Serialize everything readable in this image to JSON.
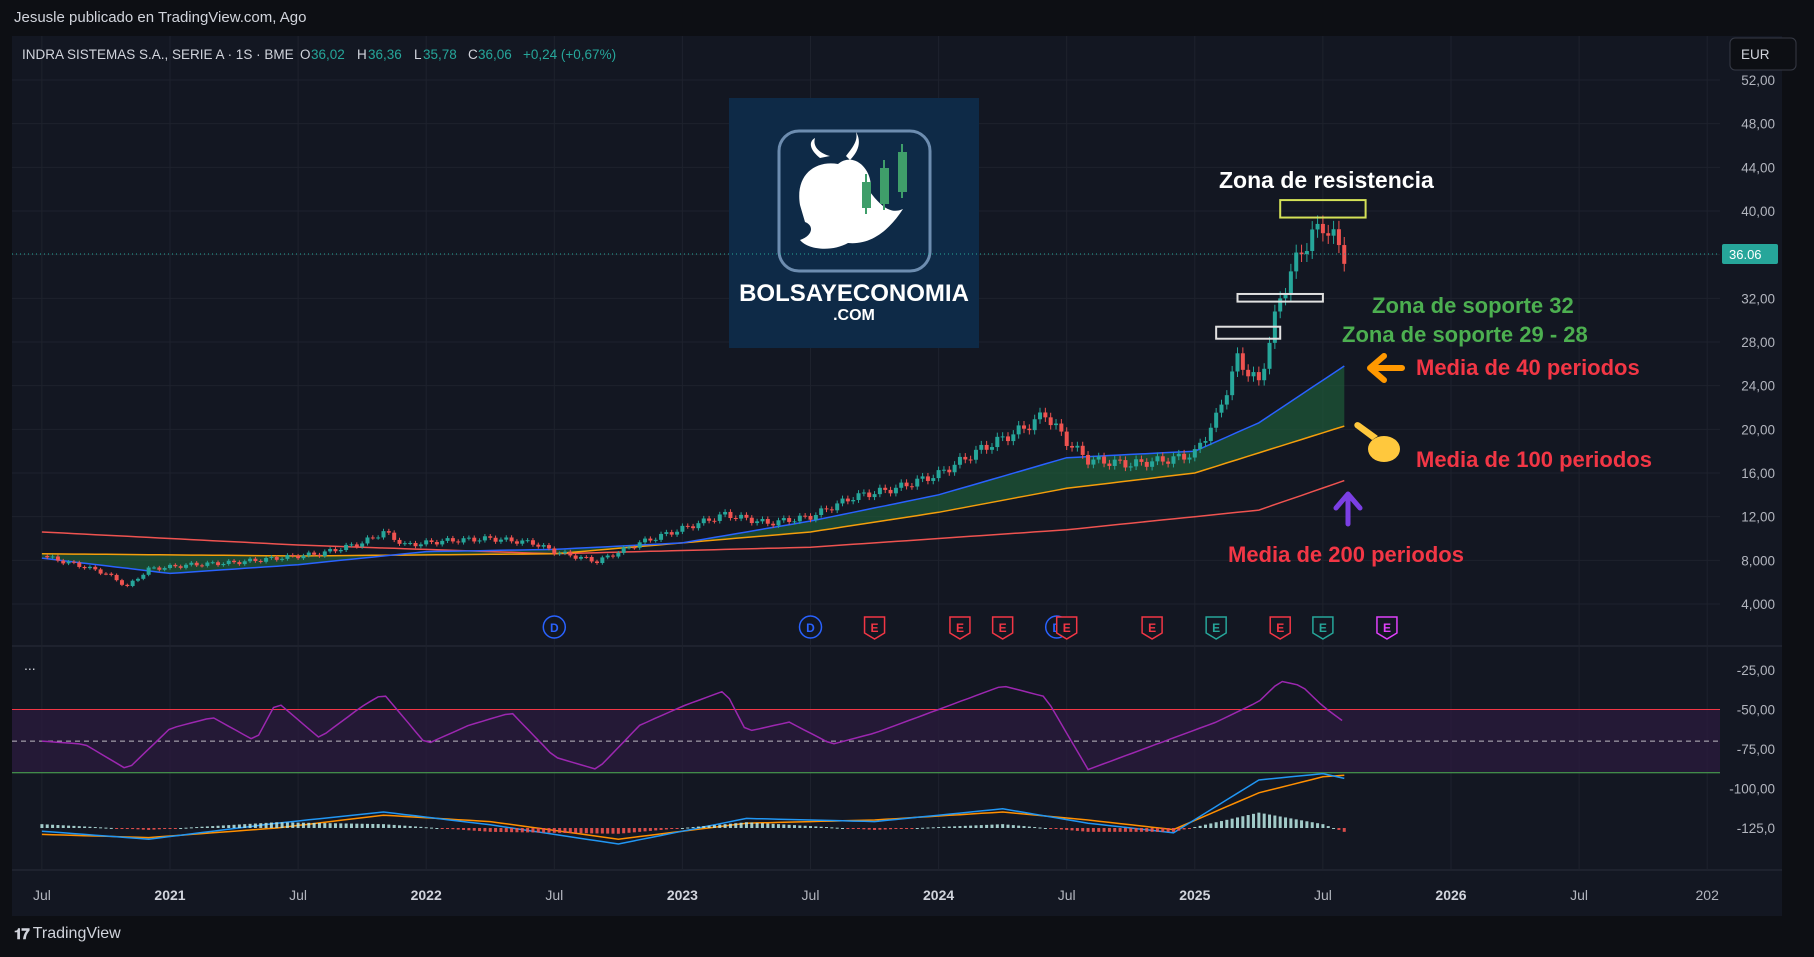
{
  "header": {
    "published_by": "Jesusle publicado en TradingView.com, Ago",
    "symbol": "INDRA SISTEMAS S.A., SERIE A · 1S · BME",
    "o_label": "O",
    "o_value": "36,02",
    "h_label": "H",
    "h_value": "36,36",
    "l_label": "L",
    "l_value": "35,78",
    "c_label": "C",
    "c_value": "36,06",
    "change": "+0,24 (+0,67%)",
    "currency": "EUR",
    "last_price": "36.06"
  },
  "footer": {
    "brand": "TradingView"
  },
  "logo": {
    "line1": "BOLSAYECONOMIA",
    "line2": ".COM"
  },
  "colors": {
    "background": "#131722",
    "ma40": "#2962ff",
    "ma100": "#f59e0b",
    "ma200": "#ef5350",
    "fill_band": "#1f5f3a",
    "rsi": "#9c27b0",
    "macd": "#2196f3",
    "signal": "#ff8f00",
    "up": "#26a69a",
    "down": "#ef5350",
    "annotation_green": "#4caf50",
    "annotation_red": "#f23645",
    "resistance_box": "#d4e157"
  },
  "annotations": {
    "resistance": "Zona de resistencia",
    "support32": "Zona de soporte 32",
    "support29": "Zona de soporte 29 - 28",
    "ma40": "Media de 40 periodos",
    "ma100": "Media de 100 periodos",
    "ma200": "Media de 200 periodos"
  },
  "chart_data": {
    "type": "line",
    "title": "INDRA SISTEMAS S.A., SERIE A · 1S · BME",
    "xlabel": "",
    "ylabel": "",
    "x_ticks": [
      "Jul",
      "2021",
      "Jul",
      "2022",
      "Jul",
      "2023",
      "Jul",
      "2024",
      "Jul",
      "2025",
      "Jul",
      "2026",
      "Jul",
      "202"
    ],
    "y_ticks": [
      "52,00",
      "48,00",
      "44,00",
      "40,00",
      "36,00",
      "32,00",
      "28,00",
      "24,00",
      "20,00",
      "16,00",
      "12,00",
      "8,000",
      "4,000"
    ],
    "ylim": [
      4,
      52
    ],
    "price_points": [
      {
        "date": "2020-07",
        "value": 8.4
      },
      {
        "date": "2020-09",
        "value": 7.4
      },
      {
        "date": "2020-10",
        "value": 6.8
      },
      {
        "date": "2020-11",
        "value": 5.6
      },
      {
        "date": "2020-12",
        "value": 7.2
      },
      {
        "date": "2021-02",
        "value": 7.6
      },
      {
        "date": "2021-04",
        "value": 7.8
      },
      {
        "date": "2021-06",
        "value": 8.2
      },
      {
        "date": "2021-08",
        "value": 8.6
      },
      {
        "date": "2021-10",
        "value": 9.6
      },
      {
        "date": "2021-11",
        "value": 10.6
      },
      {
        "date": "2021-12",
        "value": 9.4
      },
      {
        "date": "2022-02",
        "value": 9.8
      },
      {
        "date": "2022-04",
        "value": 10.0
      },
      {
        "date": "2022-06",
        "value": 9.6
      },
      {
        "date": "2022-07",
        "value": 8.8
      },
      {
        "date": "2022-09",
        "value": 7.9
      },
      {
        "date": "2022-11",
        "value": 9.6
      },
      {
        "date": "2023-01",
        "value": 10.9
      },
      {
        "date": "2023-03",
        "value": 12.2
      },
      {
        "date": "2023-05",
        "value": 11.4
      },
      {
        "date": "2023-07",
        "value": 12.0
      },
      {
        "date": "2023-09",
        "value": 13.8
      },
      {
        "date": "2023-11",
        "value": 14.6
      },
      {
        "date": "2024-01",
        "value": 15.9
      },
      {
        "date": "2024-03",
        "value": 18.2
      },
      {
        "date": "2024-05",
        "value": 20.1
      },
      {
        "date": "2024-06",
        "value": 21.4
      },
      {
        "date": "2024-07",
        "value": 18.9
      },
      {
        "date": "2024-08",
        "value": 17.2
      },
      {
        "date": "2024-10",
        "value": 16.8
      },
      {
        "date": "2024-12",
        "value": 17.3
      },
      {
        "date": "2025-01",
        "value": 17.8
      },
      {
        "date": "2025-02",
        "value": 21.0
      },
      {
        "date": "2025-03",
        "value": 26.4
      },
      {
        "date": "2025-04",
        "value": 24.2
      },
      {
        "date": "2025-05",
        "value": 32.0
      },
      {
        "date": "2025-06",
        "value": 36.5
      },
      {
        "date": "2025-07",
        "value": 38.8
      },
      {
        "date": "2025-08",
        "value": 36.06
      }
    ],
    "series": [
      {
        "name": "Media de 40 periodos",
        "values": [
          {
            "date": "2020-07",
            "value": 8.2
          },
          {
            "date": "2021-01",
            "value": 6.8
          },
          {
            "date": "2021-07",
            "value": 7.6
          },
          {
            "date": "2022-01",
            "value": 8.8
          },
          {
            "date": "2022-07",
            "value": 9.0
          },
          {
            "date": "2023-01",
            "value": 9.6
          },
          {
            "date": "2023-07",
            "value": 11.6
          },
          {
            "date": "2024-01",
            "value": 14.0
          },
          {
            "date": "2024-07",
            "value": 17.4
          },
          {
            "date": "2025-01",
            "value": 18.0
          },
          {
            "date": "2025-04",
            "value": 20.6
          },
          {
            "date": "2025-08",
            "value": 25.8
          }
        ]
      },
      {
        "name": "Media de 100 periodos",
        "values": [
          {
            "date": "2020-07",
            "value": 8.6
          },
          {
            "date": "2021-07",
            "value": 8.4
          },
          {
            "date": "2022-07",
            "value": 8.6
          },
          {
            "date": "2023-07",
            "value": 10.6
          },
          {
            "date": "2024-01",
            "value": 12.4
          },
          {
            "date": "2024-07",
            "value": 14.6
          },
          {
            "date": "2025-01",
            "value": 16.0
          },
          {
            "date": "2025-08",
            "value": 20.3
          }
        ]
      },
      {
        "name": "Media de 200 periodos",
        "values": [
          {
            "date": "2020-07",
            "value": 10.6
          },
          {
            "date": "2021-07",
            "value": 9.4
          },
          {
            "date": "2022-07",
            "value": 8.6
          },
          {
            "date": "2023-07",
            "value": 9.2
          },
          {
            "date": "2024-07",
            "value": 10.8
          },
          {
            "date": "2025-04",
            "value": 12.6
          },
          {
            "date": "2025-08",
            "value": 15.3
          }
        ]
      }
    ],
    "zones": {
      "resistance": [
        39.4,
        41.0
      ],
      "support_32": [
        31.7,
        32.4
      ],
      "support_29_28": [
        28.3,
        29.4
      ]
    },
    "events": [
      {
        "date": "2022-07",
        "label": "D",
        "kind": "dividend"
      },
      {
        "date": "2023-07",
        "label": "D",
        "kind": "dividend"
      },
      {
        "date": "2023-10",
        "label": "E",
        "kind": "earnings"
      },
      {
        "date": "2024-02",
        "label": "E",
        "kind": "earnings"
      },
      {
        "date": "2024-04",
        "label": "E",
        "kind": "earnings"
      },
      {
        "date": "2024-07",
        "label": "D",
        "kind": "dividend"
      },
      {
        "date": "2024-07",
        "label": "E",
        "kind": "earnings"
      },
      {
        "date": "2024-11",
        "label": "E",
        "kind": "earnings"
      },
      {
        "date": "2025-02",
        "label": "E",
        "kind": "earnings"
      },
      {
        "date": "2025-05",
        "label": "E",
        "kind": "earnings"
      },
      {
        "date": "2025-07",
        "label": "E",
        "kind": "earnings"
      },
      {
        "date": "2025-10",
        "label": "E",
        "kind": "earnings"
      }
    ],
    "rsi_panel": {
      "y_ticks": [
        "-25,00",
        "-50,00",
        "-75,00",
        "-100,00",
        "-125,0"
      ],
      "ylim": [
        -130,
        -20
      ],
      "band": [
        -50,
        -90
      ],
      "dots_label": "...",
      "values": [
        {
          "date": "2020-07",
          "value": -70
        },
        {
          "date": "2020-09",
          "value": -72
        },
        {
          "date": "2020-11",
          "value": -88
        },
        {
          "date": "2021-01",
          "value": -62
        },
        {
          "date": "2021-03",
          "value": -55
        },
        {
          "date": "2021-05",
          "value": -70
        },
        {
          "date": "2021-06",
          "value": -45
        },
        {
          "date": "2021-08",
          "value": -68
        },
        {
          "date": "2021-10",
          "value": -48
        },
        {
          "date": "2021-11",
          "value": -40
        },
        {
          "date": "2022-01",
          "value": -72
        },
        {
          "date": "2022-03",
          "value": -60
        },
        {
          "date": "2022-05",
          "value": -52
        },
        {
          "date": "2022-07",
          "value": -80
        },
        {
          "date": "2022-09",
          "value": -88
        },
        {
          "date": "2022-11",
          "value": -60
        },
        {
          "date": "2023-01",
          "value": -48
        },
        {
          "date": "2023-03",
          "value": -38
        },
        {
          "date": "2023-04",
          "value": -64
        },
        {
          "date": "2023-06",
          "value": -58
        },
        {
          "date": "2023-08",
          "value": -72
        },
        {
          "date": "2023-10",
          "value": -65
        },
        {
          "date": "2023-12",
          "value": -55
        },
        {
          "date": "2024-02",
          "value": -45
        },
        {
          "date": "2024-04",
          "value": -35
        },
        {
          "date": "2024-06",
          "value": -42
        },
        {
          "date": "2024-08",
          "value": -88
        },
        {
          "date": "2024-10",
          "value": -78
        },
        {
          "date": "2024-12",
          "value": -68
        },
        {
          "date": "2025-02",
          "value": -58
        },
        {
          "date": "2025-04",
          "value": -45
        },
        {
          "date": "2025-05",
          "value": -32
        },
        {
          "date": "2025-06",
          "value": -35
        },
        {
          "date": "2025-07",
          "value": -48
        },
        {
          "date": "2025-08",
          "value": -58
        }
      ]
    },
    "macd_panel": {
      "macd": [
        {
          "date": "2020-07",
          "value": -2
        },
        {
          "date": "2020-12",
          "value": -7
        },
        {
          "date": "2021-06",
          "value": 3
        },
        {
          "date": "2021-11",
          "value": 10
        },
        {
          "date": "2022-04",
          "value": 2
        },
        {
          "date": "2022-10",
          "value": -10
        },
        {
          "date": "2023-04",
          "value": 6
        },
        {
          "date": "2023-10",
          "value": 4
        },
        {
          "date": "2024-04",
          "value": 12
        },
        {
          "date": "2024-08",
          "value": 3
        },
        {
          "date": "2024-12",
          "value": -3
        },
        {
          "date": "2025-04",
          "value": 30
        },
        {
          "date": "2025-07",
          "value": 34
        },
        {
          "date": "2025-08",
          "value": 31
        }
      ],
      "signal": [
        {
          "date": "2020-07",
          "value": -4
        },
        {
          "date": "2020-12",
          "value": -6
        },
        {
          "date": "2021-06",
          "value": 0
        },
        {
          "date": "2021-11",
          "value": 8
        },
        {
          "date": "2022-04",
          "value": 4
        },
        {
          "date": "2022-10",
          "value": -7
        },
        {
          "date": "2023-04",
          "value": 3
        },
        {
          "date": "2023-10",
          "value": 5
        },
        {
          "date": "2024-04",
          "value": 10
        },
        {
          "date": "2024-08",
          "value": 5
        },
        {
          "date": "2024-12",
          "value": -1
        },
        {
          "date": "2025-04",
          "value": 22
        },
        {
          "date": "2025-07",
          "value": 32
        },
        {
          "date": "2025-08",
          "value": 33
        }
      ]
    }
  }
}
